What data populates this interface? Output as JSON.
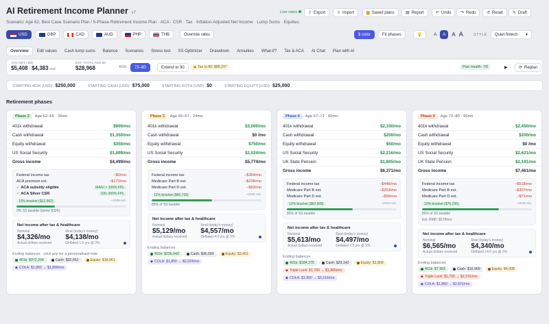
{
  "app": {
    "title": "AI Retirement Income Planner",
    "version": "v7",
    "subtitle": "Scenario: Age 62, Best Case Scenario Plan / 5-Phase Retirement Income Plan · ACA · CSR · Tax · Inflation-Adjusted Net Income · Lump Sums · Equities"
  },
  "top_actions": {
    "live": "Live rates",
    "export": "Export",
    "import": "Import",
    "saved": "Saved plans",
    "report": "Report",
    "undo": "Undo",
    "redo": "Redo",
    "reset": "Reset",
    "draft": "Draft"
  },
  "currencies": [
    "USD",
    "GBP",
    "CAD",
    "AUD",
    "PHP",
    "THB"
  ],
  "override": "Override rates",
  "color_btn": "$ color",
  "fit_btn": "Fit phases",
  "font_sizes": [
    "A",
    "A",
    "A",
    "A"
  ],
  "style_label": "STYLE",
  "style_value": "Quiet fintech",
  "tabs": [
    "Overview",
    "Edit values",
    "Cash lump sums",
    "Balance",
    "Scenarios",
    "Stress test",
    "SS Optimizer",
    "Drawdown",
    "Annuities",
    "What-if?",
    "Tax & ACA",
    "AI Chat",
    "Plan with AI"
  ],
  "summary": {
    "net_label": "AVG NET / MO",
    "net_usd": "$5,408",
    "net_local": "$4,383",
    "net_suffix": "real",
    "total_label": "EST. TOTAL AGE 80",
    "total": "$28,968",
    "age_label": "AGE",
    "age_range": "72–80",
    "extend": "Extend to 90",
    "tax_pill": "Tax to 80: $85,237",
    "health": "Plan Health: 7/8",
    "replan": "Replan"
  },
  "starting": [
    {
      "label": "STARTING 401K (USD)",
      "value": "$250,000"
    },
    {
      "label": "STARTING CASH (USD)",
      "value": "$75,000"
    },
    {
      "label": "STARTING ROTH (USD)",
      "value": "$0"
    },
    {
      "label": "STARTING EQUITY (USD)",
      "value": "$25,000"
    }
  ],
  "section_title": "Retirement phases",
  "phases": [
    {
      "badge": "Phase 2",
      "ages": "Age 62–65 · 36mo",
      "lines": [
        [
          "401k withdrawal",
          "$900/mo"
        ],
        [
          "Cash withdrawal",
          "$1,350/mo"
        ],
        [
          "Equity withdrawal",
          "$350/mo"
        ],
        [
          "US Social Security",
          "$1,899/mo"
        ]
      ],
      "gross": [
        "Gross income",
        "$4,499/mo"
      ],
      "tax": [
        [
          "Federal income tax",
          "−$0/mo"
        ],
        [
          "ACA premium est.",
          "−$173/mo"
        ]
      ],
      "aca": [
        [
          "ACA subsidy eligible",
          "MAGI > 100% FPL"
        ],
        [
          "ACA Silver CSR",
          "100–250% FPL"
        ]
      ],
      "bracket": "10% bracket ($12,962)",
      "bracket_note": "~2028 est.",
      "ss_note": "0% SS taxable (below $32K)",
      "net_title": "Net income after tax & healthcare",
      "nominal": "$4,326/mo",
      "real": "$4,138/mo",
      "nom_sub": "Actual dollars received",
      "real_sub": "Deflated 1.5 yrs @ 3%",
      "balances_title": "Ending balances · click any for a personalised note",
      "balances": [
        [
          "401k: $372,294",
          "c1"
        ],
        [
          "Cash: $32,561",
          "c2"
        ],
        [
          "Equity: $18,061",
          "c3"
        ]
      ],
      "cola": [
        [
          "COLA: $1,850 → $1,899/mo",
          "c4"
        ]
      ]
    },
    {
      "badge": "Phase 3",
      "ages": "Age 65–67 · 24mo",
      "lines": [
        [
          "401k withdrawal",
          "$3,000/mo"
        ],
        [
          "Cash withdrawal",
          "$0 /mo"
        ],
        [
          "Equity withdrawal",
          "$750/mo"
        ],
        [
          "US Social Security",
          "$2,024/mo"
        ]
      ],
      "gross": [
        "Gross income",
        "$5,774/mo"
      ],
      "tax": [
        [
          "Federal income tax",
          "−$364/mo"
        ],
        [
          "Medicare Part B est.",
          "−$228/mo"
        ],
        [
          "Medicare Part D est.",
          "−$53/mo"
        ]
      ],
      "aca": [],
      "bracket": "12% bracket ($56,726)",
      "bracket_note": "~2030 est.",
      "ss_note": "85% of SS taxable",
      "net_title": "Net income after tax & healthcare",
      "nominal": "$5,129/mo",
      "real": "$4,557/mo",
      "nom_sub": "Actual dollars received",
      "real_sub": "Deflated 4.0 yrs @ 3%",
      "balances_title": "Ending balances",
      "balances": [
        [
          "401k: $236,043",
          "c1"
        ],
        [
          "Cash: $36,093",
          "c2"
        ],
        [
          "Equity: $3,451",
          "c3"
        ]
      ],
      "cola": [
        [
          "COLA: $1,850 → $2,024/mo",
          "c4"
        ]
      ]
    },
    {
      "badge": "Phase 4",
      "ages": "Age 67–72 · 60mo",
      "lines": [
        [
          "401k withdrawal",
          "$2,100/mo"
        ],
        [
          "Cash withdrawal",
          "$200/mo"
        ],
        [
          "Equity withdrawal",
          "$50/mo"
        ],
        [
          "US Social Security",
          "$2,216/mo"
        ],
        [
          "UK State Pension",
          "$1,805/mo"
        ]
      ],
      "gross": [
        "Gross income",
        "$6,371/mo"
      ],
      "tax": [
        [
          "Federal income tax",
          "−$446/mo"
        ],
        [
          "Medicare Part B est.",
          "−$253/mo"
        ],
        [
          "Medicare Part D est.",
          "−$59/mo"
        ]
      ],
      "aca": [],
      "bracket": "12% bracket ($62,909)",
      "bracket_note": "~2034 est.",
      "ss_note": "85% of SS taxable",
      "net_title": "Net income after tax & healthcare",
      "nominal": "$5,613/mo",
      "real": "$4,497/mo",
      "nom_sub": "Actual dollars received",
      "real_sub": "Deflated 7.5 yrs @ 3%",
      "balances_title": "Ending balances",
      "balances": [
        [
          "401k: $184,375",
          "c1"
        ],
        [
          "Cash: $29,142",
          "c2"
        ],
        [
          "Equity: $1,808",
          "c3"
        ]
      ],
      "cola": [
        [
          "Triple Lock: $1,700 → $1,805/mo",
          "c5"
        ],
        [
          "COLA: $1,850 → $2,216/mo",
          "c4"
        ]
      ]
    },
    {
      "badge": "Phase 5",
      "ages": "Age 72–80 · 96mo",
      "lines": [
        [
          "401k withdrawal",
          "$2,450/mo"
        ],
        [
          "Cash withdrawal",
          "$200/mo"
        ],
        [
          "Equity withdrawal",
          "$0 /mo"
        ],
        [
          "US Social Security",
          "$2,621/mo"
        ],
        [
          "UK State Pension",
          "$2,191/mo"
        ]
      ],
      "gross": [
        "Gross income",
        "$7,461/mo"
      ],
      "tax": [
        [
          "Federal income tax",
          "−$518/mo"
        ],
        [
          "Medicare Part B est.",
          "−$307/mo"
        ],
        [
          "Medicare Part D est.",
          "−$71/mo"
        ]
      ],
      "aca": [],
      "bracket": "12% bracket ($76,235)",
      "bracket_note": "~2040 est.",
      "ss_note": "85% of SS taxable",
      "extra_note": "Est. RMD: $578/mo",
      "net_title": "Net income after tax & healthcare",
      "nominal": "$6,565/mo",
      "real": "$4,340/mo",
      "nom_sub": "Actual dollars received",
      "real_sub": "Deflated 14.0 yrs @ 3%",
      "balances_title": "Ending balances",
      "balances": [
        [
          "401k: $7,983",
          "c1"
        ],
        [
          "Cash: $16,969",
          "c2"
        ],
        [
          "Equity: $4,008",
          "c3"
        ]
      ],
      "cola": [
        [
          "Triple Lock: $1,700 → $2,191/mo",
          "c5"
        ],
        [
          "COLA: $1,850 → $2,621/mo",
          "c4"
        ]
      ]
    }
  ],
  "colors": {
    "accent": "#4a5ae0",
    "green": "#1f8a4c",
    "red": "#c0392b",
    "phase_badges": [
      "#e3f1e6",
      "#fdf0d2",
      "#e4e8fb",
      "#fde7dc"
    ],
    "phase_text": [
      "#2c7a44",
      "#8a6010",
      "#3f4fb0",
      "#a04a26"
    ]
  },
  "bracket_fill": [
    0.35,
    0.55,
    0.6,
    0.7
  ]
}
